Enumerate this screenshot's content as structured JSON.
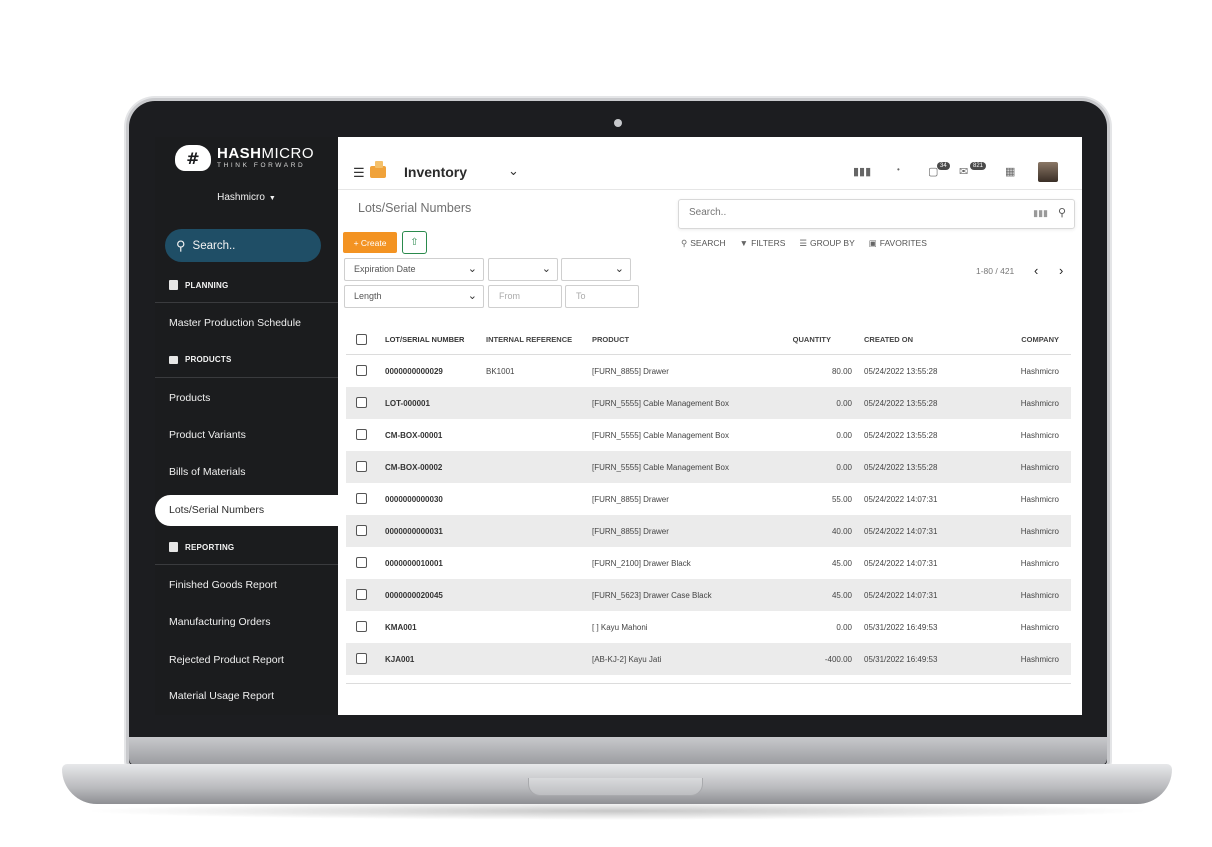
{
  "brand": {
    "name_bold": "HASH",
    "name_light": "MICRO",
    "tagline": "THINK FORWARD",
    "logo_mark": "#"
  },
  "sidebar": {
    "company": "Hashmicro",
    "search_label": "Search..",
    "sections": {
      "planning": "PLANNING",
      "products": "PRODUCTS",
      "reporting": "REPORTING"
    },
    "items": {
      "master_production_schedule": "Master Production Schedule",
      "products": "Products",
      "product_variants": "Product Variants",
      "bills_of_materials": "Bills of Materials",
      "lots_serial_numbers": "Lots/Serial Numbers",
      "finished_goods_report": "Finished Goods Report",
      "manufacturing_orders": "Manufacturing Orders",
      "rejected_product_report": "Rejected Product Report",
      "material_usage_report": "Material Usage Report"
    },
    "active_item": "Lots/Serial Numbers",
    "colors": {
      "background": "#1b1c1e",
      "search_bg": "#1f4e66"
    }
  },
  "topbar": {
    "app_title": "Inventory",
    "chat_count": "34",
    "message_count": "821"
  },
  "breadcrumb": "Lots/Serial Numbers",
  "search": {
    "placeholder": "Search..",
    "options": {
      "search": "SEARCH",
      "filters": "FILTERS",
      "group_by": "GROUP BY",
      "favorites": "FAVORITES"
    }
  },
  "actions": {
    "create": "+ Create"
  },
  "filters": {
    "expiration_date": "Expiration Date",
    "length": "Length",
    "from_placeholder": "From",
    "to_placeholder": "To"
  },
  "pager": {
    "range": "1-80 / 421"
  },
  "table": {
    "headers": {
      "lot": "LOT/SERIAL NUMBER",
      "internal_reference": "INTERNAL REFERENCE",
      "product": "PRODUCT",
      "quantity": "QUANTITY",
      "created_on": "CREATED ON",
      "company": "COMPANY"
    },
    "rows": [
      {
        "lot": "0000000000029",
        "ref": "BK1001",
        "product": "[FURN_8855] Drawer",
        "qty": "80.00",
        "created": "05/24/2022 13:55:28",
        "company": "Hashmicro"
      },
      {
        "lot": "LOT-000001",
        "ref": "",
        "product": "[FURN_5555] Cable Management Box",
        "qty": "0.00",
        "created": "05/24/2022 13:55:28",
        "company": "Hashmicro"
      },
      {
        "lot": "CM-BOX-00001",
        "ref": "",
        "product": "[FURN_5555] Cable Management Box",
        "qty": "0.00",
        "created": "05/24/2022 13:55:28",
        "company": "Hashmicro"
      },
      {
        "lot": "CM-BOX-00002",
        "ref": "",
        "product": "[FURN_5555] Cable Management Box",
        "qty": "0.00",
        "created": "05/24/2022 13:55:28",
        "company": "Hashmicro"
      },
      {
        "lot": "0000000000030",
        "ref": "",
        "product": "[FURN_8855] Drawer",
        "qty": "55.00",
        "created": "05/24/2022 14:07:31",
        "company": "Hashmicro"
      },
      {
        "lot": "0000000000031",
        "ref": "",
        "product": "[FURN_8855] Drawer",
        "qty": "40.00",
        "created": "05/24/2022 14:07:31",
        "company": "Hashmicro"
      },
      {
        "lot": "0000000010001",
        "ref": "",
        "product": "[FURN_2100] Drawer Black",
        "qty": "45.00",
        "created": "05/24/2022 14:07:31",
        "company": "Hashmicro"
      },
      {
        "lot": "0000000020045",
        "ref": "",
        "product": "[FURN_5623] Drawer Case Black",
        "qty": "45.00",
        "created": "05/24/2022 14:07:31",
        "company": "Hashmicro"
      },
      {
        "lot": "KMA001",
        "ref": "",
        "product": "[ ] Kayu Mahoni",
        "qty": "0.00",
        "created": "05/31/2022 16:49:53",
        "company": "Hashmicro"
      },
      {
        "lot": "KJA001",
        "ref": "",
        "product": "[AB-KJ-2] Kayu Jati",
        "qty": "-400.00",
        "created": "05/31/2022 16:49:53",
        "company": "Hashmicro"
      }
    ]
  },
  "colors": {
    "accent": "#f39322",
    "upload_green": "#2a8a4c"
  }
}
